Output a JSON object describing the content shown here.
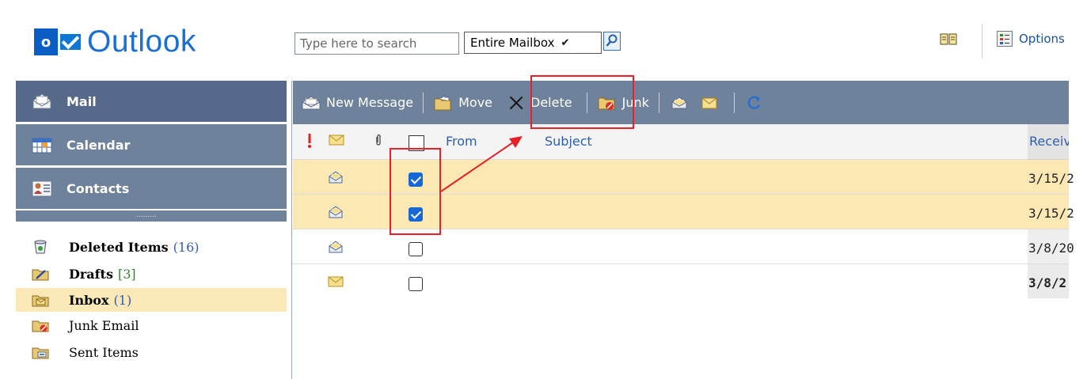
{
  "app": {
    "logo_text": "Outlook",
    "logo_letter": "o"
  },
  "search": {
    "placeholder": "Type here to search",
    "scope": "Entire Mailbox"
  },
  "header": {
    "options_label": "Options",
    "icons": [
      "address-book-icon",
      "options-icon",
      "search-icon"
    ]
  },
  "nav": {
    "buttons": [
      {
        "label": "Mail",
        "icon": "mail-icon"
      },
      {
        "label": "Calendar",
        "icon": "calendar-icon"
      },
      {
        "label": "Contacts",
        "icon": "contacts-icon"
      }
    ],
    "grip": "........."
  },
  "folders": [
    {
      "name": "Deleted Items",
      "count": "(16)",
      "bold": true,
      "icon": "trash-icon"
    },
    {
      "name": "Drafts",
      "count": "[3]",
      "bold": true,
      "icon": "drafts-icon"
    },
    {
      "name": "Inbox",
      "count": "(1)",
      "bold": true,
      "selected": true,
      "icon": "inbox-icon"
    },
    {
      "name": "Junk Email",
      "count": "",
      "bold": false,
      "icon": "junk-icon"
    },
    {
      "name": "Sent Items",
      "count": "",
      "bold": false,
      "icon": "sent-icon"
    }
  ],
  "toolbar": {
    "new_message": "New Message",
    "move": "Move",
    "delete": "Delete",
    "junk": "Junk"
  },
  "list": {
    "headers": {
      "from": "From",
      "subject": "Subject",
      "received": "Received"
    },
    "rows": [
      {
        "read": true,
        "checked": true,
        "date": "3/15/2",
        "date_bold": false
      },
      {
        "read": true,
        "checked": true,
        "date": "3/15/2",
        "date_bold": false
      },
      {
        "read": true,
        "checked": false,
        "date": "3/8/20",
        "date_bold": false
      },
      {
        "read": false,
        "checked": false,
        "date": "3/8/2",
        "date_bold": true
      }
    ]
  },
  "colors": {
    "nav_bg": "#6f829b",
    "selection": "#fbe8b3",
    "highlight": "#e8202a",
    "link": "#2f5fb0",
    "checkbox_on": "#1668d6"
  }
}
